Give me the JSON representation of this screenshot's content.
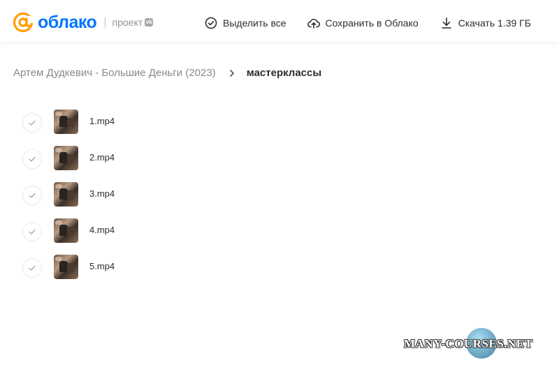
{
  "header": {
    "logo_text": "облако",
    "separator": "|",
    "project_label": "проект",
    "vk_badge": "vk",
    "actions": {
      "select_all": "Выделить все",
      "save_to_cloud": "Сохранить в Облако",
      "download": "Скачать 1.39 ГБ"
    }
  },
  "breadcrumb": {
    "parent": "Артем Дудкевич - Большие Деньги (2023)",
    "current": "мастерклассы"
  },
  "files": [
    {
      "name": "1.mp4"
    },
    {
      "name": "2.mp4"
    },
    {
      "name": "3.mp4"
    },
    {
      "name": "4.mp4"
    },
    {
      "name": "5.mp4"
    }
  ],
  "watermark": {
    "text": "MANY-COURSES.NET"
  },
  "colors": {
    "brand": "#0077ff",
    "logo_at": "#ff9e00",
    "text": "#2c2d2e",
    "muted": "#87898f"
  }
}
